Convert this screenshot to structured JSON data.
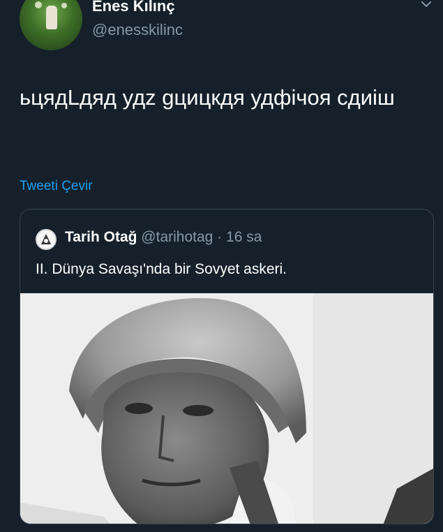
{
  "author": {
    "display_name": "Enes Kılınç",
    "handle": "@enesskilinc"
  },
  "tweet": {
    "text": "ьцядLдяд удz gцицкдя удфічоя сдиiш",
    "translate_label": "Tweeti Çevir"
  },
  "quoted": {
    "name": "Tarih Otağ",
    "handle": "@tarihotag",
    "time": "· 16 sa",
    "text": "II. Dünya Savaşı'nda bir Sovyet askeri."
  },
  "icons": {
    "more": "chevron-down-icon",
    "quoted_avatar": "logo-icon"
  },
  "colors": {
    "background": "#15202b",
    "link": "#1da1f2",
    "secondary_text": "#8899a6",
    "border": "#38444d"
  }
}
